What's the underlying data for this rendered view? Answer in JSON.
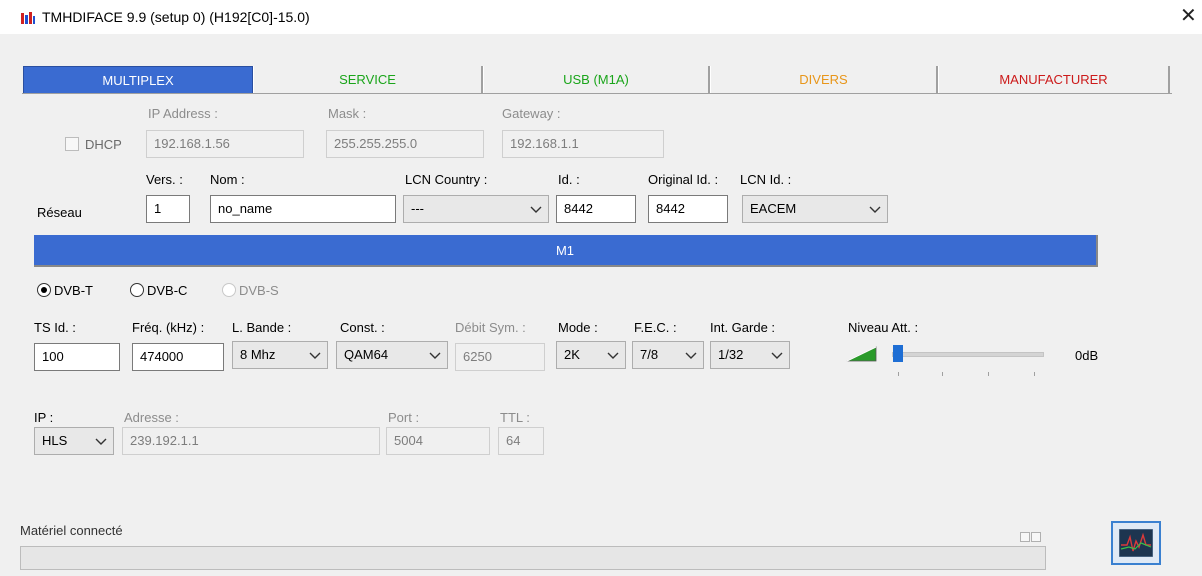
{
  "window": {
    "title": "TMHDIFACE 9.9 (setup 0) (H192[C0]-15.0)"
  },
  "tabs": [
    {
      "label": "MULTIPLEX",
      "color": "#ffffff"
    },
    {
      "label": "SERVICE",
      "color": "#1aa51a"
    },
    {
      "label": "USB (M1A)",
      "color": "#1aa51a"
    },
    {
      "label": "DIVERS",
      "color": "#e8961a"
    },
    {
      "label": "MANUFACTURER",
      "color": "#cc1a1a"
    }
  ],
  "network": {
    "dhcp_label": "DHCP",
    "ip_label": "IP Address :",
    "ip_value": "192.168.1.56",
    "mask_label": "Mask :",
    "mask_value": "255.255.255.0",
    "gateway_label": "Gateway :",
    "gateway_value": "192.168.1.1"
  },
  "reseau": {
    "label": "Réseau",
    "vers_label": "Vers. :",
    "vers_value": "1",
    "nom_label": "Nom :",
    "nom_value": "no_name",
    "lcn_country_label": "LCN Country :",
    "lcn_country_value": "---",
    "id_label": "Id. :",
    "id_value": "8442",
    "original_id_label": "Original Id. :",
    "original_id_value": "8442",
    "lcn_id_label": "LCN Id. :",
    "lcn_id_value": "EACEM"
  },
  "mux_bar": "M1",
  "modulation": {
    "dvbt": "DVB-T",
    "dvbc": "DVB-C",
    "dvbs": "DVB-S",
    "selected": "DVB-T"
  },
  "params": {
    "tsid_label": "TS Id. :",
    "tsid_value": "100",
    "freq_label": "Fréq. (kHz) :",
    "freq_value": "474000",
    "bande_label": "L. Bande :",
    "bande_value": "8 Mhz",
    "const_label": "Const. :",
    "const_value": "QAM64",
    "debit_label": "Débit Sym. :",
    "debit_value": "6250",
    "mode_label": "Mode :",
    "mode_value": "2K",
    "fec_label": "F.E.C. :",
    "fec_value": "7/8",
    "garde_label": "Int. Garde :",
    "garde_value": "1/32",
    "niveau_label": "Niveau Att. :",
    "niveau_value": "0dB",
    "niveau_level": 0
  },
  "ip": {
    "ip_label": "IP :",
    "ip_value": "HLS",
    "adresse_label": "Adresse :",
    "adresse_value": "239.192.1.1",
    "port_label": "Port :",
    "port_value": "5004",
    "ttl_label": "TTL :",
    "ttl_value": "64"
  },
  "status": {
    "label": "Matériel connecté"
  },
  "colors": {
    "accent": "#3a6bd1"
  }
}
